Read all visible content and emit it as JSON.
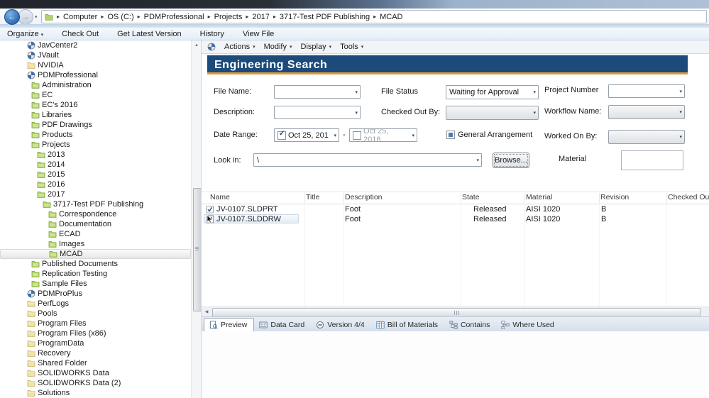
{
  "chrome": {
    "breadcrumb": {
      "items": [
        "Computer",
        "OS (C:)",
        "PDMProfessional",
        "Projects",
        "2017",
        "3717-Test PDF Publishing",
        "MCAD"
      ]
    },
    "toolbar": {
      "buttons": [
        {
          "label": "Organize",
          "dropdown": true
        },
        {
          "label": "Check Out",
          "dropdown": false
        },
        {
          "label": "Get Latest Version",
          "dropdown": false
        },
        {
          "label": "History",
          "dropdown": false
        },
        {
          "label": "View File",
          "dropdown": false
        }
      ]
    }
  },
  "tree": {
    "items": [
      {
        "label": "JavCenter2",
        "level": 0,
        "icon": "vault-icon",
        "selected": false
      },
      {
        "label": "JVault",
        "level": 0,
        "icon": "vault-icon",
        "selected": false
      },
      {
        "label": "NVIDIA",
        "level": 0,
        "icon": "folder-yellow-icon",
        "selected": false
      },
      {
        "label": "PDMProfessional",
        "level": 0,
        "icon": "vault-icon",
        "selected": false
      },
      {
        "label": "Administration",
        "level": 1,
        "icon": "folder-green-icon",
        "selected": false
      },
      {
        "label": "EC",
        "level": 1,
        "icon": "folder-green-icon",
        "selected": false
      },
      {
        "label": "EC's 2016",
        "level": 1,
        "icon": "folder-green-icon",
        "selected": false
      },
      {
        "label": "Libraries",
        "level": 1,
        "icon": "folder-green-icon",
        "selected": false
      },
      {
        "label": "PDF Drawings",
        "level": 1,
        "icon": "folder-green-icon",
        "selected": false
      },
      {
        "label": "Products",
        "level": 1,
        "icon": "folder-green-icon",
        "selected": false
      },
      {
        "label": "Projects",
        "level": 1,
        "icon": "folder-green-icon",
        "selected": false
      },
      {
        "label": "2013",
        "level": 2,
        "icon": "folder-green-icon",
        "selected": false
      },
      {
        "label": "2014",
        "level": 2,
        "icon": "folder-green-icon",
        "selected": false
      },
      {
        "label": "2015",
        "level": 2,
        "icon": "folder-green-icon",
        "selected": false
      },
      {
        "label": "2016",
        "level": 2,
        "icon": "folder-green-icon",
        "selected": false
      },
      {
        "label": "2017",
        "level": 2,
        "icon": "folder-green-icon",
        "selected": false
      },
      {
        "label": "3717-Test PDF Publishing",
        "level": 3,
        "icon": "folder-green-icon",
        "selected": false
      },
      {
        "label": "Correspondence",
        "level": 4,
        "icon": "folder-green-icon",
        "selected": false
      },
      {
        "label": "Documentation",
        "level": 4,
        "icon": "folder-green-icon",
        "selected": false
      },
      {
        "label": "ECAD",
        "level": 4,
        "icon": "folder-green-icon",
        "selected": false
      },
      {
        "label": "Images",
        "level": 4,
        "icon": "folder-green-icon",
        "selected": false
      },
      {
        "label": "MCAD",
        "level": 4,
        "icon": "folder-green-icon",
        "selected": true
      },
      {
        "label": "Published Documents",
        "level": 1,
        "icon": "folder-green-icon",
        "selected": false
      },
      {
        "label": "Replication Testing",
        "level": 1,
        "icon": "folder-green-icon",
        "selected": false
      },
      {
        "label": "Sample Files",
        "level": 1,
        "icon": "folder-green-icon",
        "selected": false
      },
      {
        "label": "PDMProPlus",
        "level": 0,
        "icon": "vault-icon",
        "selected": false
      },
      {
        "label": "PerfLogs",
        "level": 0,
        "icon": "folder-yellow-icon",
        "selected": false
      },
      {
        "label": "Pools",
        "level": 0,
        "icon": "folder-yellow-icon",
        "selected": false
      },
      {
        "label": "Program Files",
        "level": 0,
        "icon": "folder-yellow-icon",
        "selected": false
      },
      {
        "label": "Program Files (x86)",
        "level": 0,
        "icon": "folder-yellow-icon",
        "selected": false
      },
      {
        "label": "ProgramData",
        "level": 0,
        "icon": "folder-yellow-icon",
        "selected": false
      },
      {
        "label": "Recovery",
        "level": 0,
        "icon": "folder-yellow-icon",
        "selected": false
      },
      {
        "label": "Shared Folder",
        "level": 0,
        "icon": "folder-yellow-icon",
        "selected": false
      },
      {
        "label": "SOLIDWORKS Data",
        "level": 0,
        "icon": "folder-yellow-icon",
        "selected": false
      },
      {
        "label": "SOLIDWORKS Data (2)",
        "level": 0,
        "icon": "folder-yellow-icon",
        "selected": false
      },
      {
        "label": "Solutions",
        "level": 0,
        "icon": "folder-yellow-icon",
        "selected": false
      }
    ]
  },
  "menubar": {
    "items": [
      "Actions",
      "Modify",
      "Display",
      "Tools"
    ]
  },
  "search_panel": {
    "title": "Engineering Search",
    "colors": {
      "header_bg": "#1b4a7b",
      "header_accent": "#e09a3e"
    },
    "fields": {
      "file_name_label": "File Name:",
      "file_name_value": "",
      "description_label": "Description:",
      "description_value": "",
      "date_range_label": "Date Range:",
      "date_from": "Oct 25, 201",
      "date_from_checked": true,
      "date_to": "Oct 25, 2016",
      "date_to_checked": false,
      "date_separator": "-",
      "look_in_label": "Look in:",
      "look_in_value": "\\",
      "browse_label": "Browse...",
      "file_status_label": "File Status",
      "file_status_value": "Waiting for Approval",
      "checked_out_by_label": "Checked Out By:",
      "checked_out_by_value": "",
      "general_arrangement_label": "General Arrangement",
      "general_arrangement_checked": "partial",
      "project_number_label": "Project Number",
      "project_number_value": "",
      "workflow_name_label": "Workflow Name:",
      "workflow_name_value": "",
      "worked_on_by_label": "Worked On By:",
      "worked_on_by_value": "",
      "material_label": "Material",
      "material_value": ""
    }
  },
  "results": {
    "columns": [
      "Name",
      "Title",
      "Description",
      "State",
      "Material",
      "Revision",
      "Checked Out By"
    ],
    "rows": [
      {
        "icon": "solidworks-part-icon",
        "name": "JV-0107.SLDPRT",
        "title": "",
        "description": "Foot",
        "state": "Released",
        "material": "AISI 1020",
        "revision": "B",
        "checked_out_by": "",
        "selected": false,
        "cursor": false
      },
      {
        "icon": "solidworks-drawing-icon",
        "name": "JV-0107.SLDDRW",
        "title": "",
        "description": "Foot",
        "state": "Released",
        "material": "AISI 1020",
        "revision": "B",
        "checked_out_by": "",
        "selected": true,
        "cursor": true
      }
    ]
  },
  "tabs": {
    "items": [
      {
        "label": "Preview",
        "icon": "preview-icon",
        "active": true
      },
      {
        "label": "Data Card",
        "icon": "data-card-icon",
        "active": false
      },
      {
        "label": "Version 4/4",
        "icon": "version-icon",
        "active": false
      },
      {
        "label": "Bill of Materials",
        "icon": "bom-icon",
        "active": false
      },
      {
        "label": "Contains",
        "icon": "contains-icon",
        "active": false
      },
      {
        "label": "Where Used",
        "icon": "where-used-icon",
        "active": false
      }
    ]
  }
}
